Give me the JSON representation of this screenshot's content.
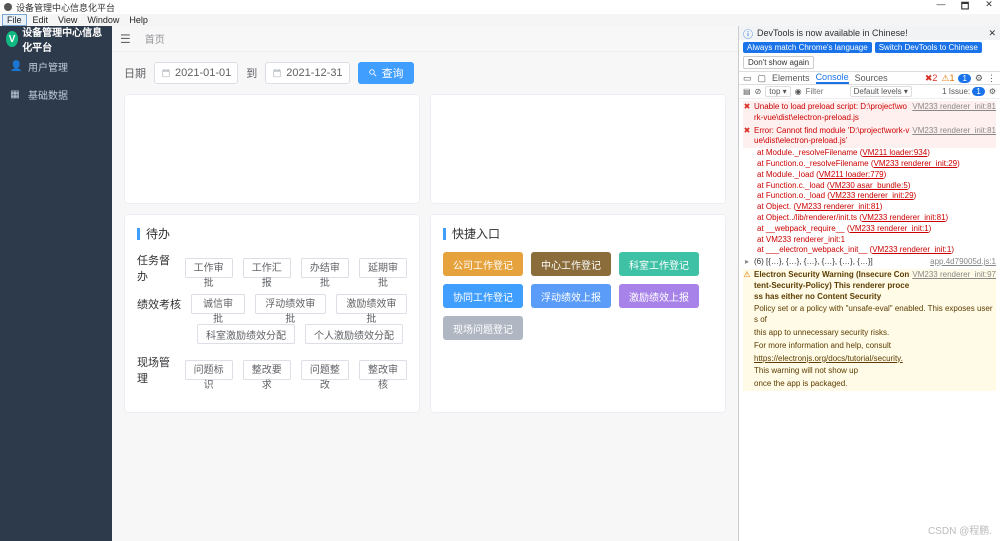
{
  "window": {
    "title": "设备管理中心信息化平台",
    "controls": {
      "min": "—",
      "max": "🗖",
      "close": "✕"
    }
  },
  "menubar": [
    "File",
    "Edit",
    "View",
    "Window",
    "Help"
  ],
  "app": {
    "logo_letter": "V",
    "logo_title": "设备管理中心信息化平台",
    "side": [
      {
        "icon": "👤",
        "label": "用户管理"
      },
      {
        "icon": "▦",
        "label": "基础数据"
      }
    ],
    "crumb": "首页",
    "filter": {
      "date_lbl": "日期",
      "to_lbl": "到",
      "d1": "2021-01-01",
      "d2": "2021-12-31",
      "search": "查询"
    },
    "todo_title": "待办",
    "sections": [
      {
        "label": "任务督办",
        "btns": [
          "工作审批",
          "工作汇报",
          "办结审批",
          "延期审批"
        ]
      },
      {
        "label": "绩效考核",
        "btns": [
          "诚信审批",
          "浮动绩效审批",
          "激励绩效审批"
        ]
      },
      {
        "label": "",
        "btns": [
          "科室激励绩效分配",
          "个人激励绩效分配"
        ]
      },
      {
        "label": "现场管理",
        "btns": [
          "问题标识",
          "整改要求",
          "问题整改",
          "整改审核"
        ]
      }
    ],
    "quick_title": "快捷入口",
    "quick": [
      {
        "t": "公司工作登记",
        "c": "q-orange"
      },
      {
        "t": "中心工作登记",
        "c": "q-brown"
      },
      {
        "t": "科室工作登记",
        "c": "q-teal"
      },
      {
        "t": "协同工作登记",
        "c": "q-blue"
      },
      {
        "t": "浮动绩效上报",
        "c": "q-blue2"
      },
      {
        "t": "激励绩效上报",
        "c": "q-purple"
      },
      {
        "t": "现场问题登记",
        "c": "q-grey"
      }
    ]
  },
  "dt": {
    "notice": "DevTools is now available in Chinese!",
    "chips": [
      "Always match Chrome's language",
      "Switch DevTools to Chinese",
      "Don't show again"
    ],
    "tabs": [
      "Elements",
      "Console",
      "Sources"
    ],
    "counts": {
      "err": "2",
      "warn": "1",
      "info": "1"
    },
    "issue": "1 Issue:",
    "sub": {
      "top": "top ▾",
      "filter_ph": "Filter",
      "levels": "Default levels ▾"
    },
    "console": {
      "e1": "Unable to load preload script: D:\\project\\work-vue\\dist\\electron-preload.js",
      "e1src": "VM233 renderer_init:81",
      "e2": "Error: Cannot find module 'D:\\project\\work-vue\\dist\\electron-preload.js'",
      "e2src": "VM233 renderer_init:81",
      "stack": [
        "at Module._resolveFilename (VM211 loader:934)",
        "at Function.o._resolveFilename (VM233 renderer_init:29)",
        "at Module._load (VM211 loader:779)",
        "at Function.c._load (VM230 asar_bundle:5)",
        "at Function.o._load (VM233 renderer_init:29)",
        "at Object.<anonymous> (VM233 renderer_init:81)",
        "at Object../lib/renderer/init.ts (VM233 renderer_init:81)",
        "at __webpack_require__ (VM233 renderer_init:1)",
        "at VM233 renderer_init:1",
        "at ___electron_webpack_init__ (VM233 renderer_init:1)"
      ],
      "arr": "(6) [{…}, {…}, {…}, {…}, {…}, {…}]",
      "arrsrc": "app.4d79005d.js:1",
      "w1": "Electron Security Warning (Insecure Content-Security-Policy) This renderer process has either no Content Security",
      "w1src": "VM233 renderer_init:97",
      "w2": "Policy set or a policy with \"unsafe-eval\" enabled. This exposes users of",
      "w3": "this app to unnecessary security risks.",
      "w4": "For more information and help, consult",
      "w5": "https://electronjs.org/docs/tutorial/security.",
      "w6": "This warning will not show up",
      "w7": "once the app is packaged."
    }
  },
  "watermark": "CSDN @程鹏."
}
